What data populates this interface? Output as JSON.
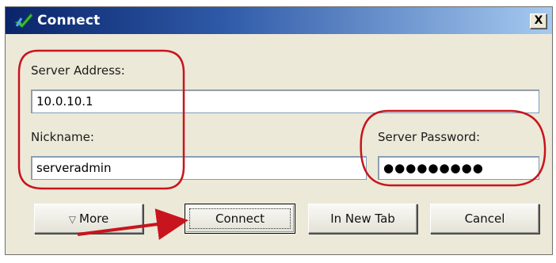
{
  "window": {
    "title": "Connect",
    "close_glyph": "X",
    "icon": "checkmark-connect-icon"
  },
  "form": {
    "server_address_label": "Server Address:",
    "server_address_value": "10.0.10.1",
    "nickname_label": "Nickname:",
    "nickname_value": "serveradmin",
    "password_label": "Server Password:",
    "password_value": "●●●●●●●●●"
  },
  "buttons": {
    "more_glyph": "▽",
    "more_label": "More",
    "connect_label": "Connect",
    "new_tab_label": "In New Tab",
    "cancel_label": "Cancel"
  },
  "annotations": {
    "circle_color": "#c8141c",
    "arrow_color": "#c8141c"
  },
  "colors": {
    "titlebar_start": "#0a246a",
    "titlebar_end": "#a6caf0",
    "dialog_bg": "#ece9d8"
  }
}
